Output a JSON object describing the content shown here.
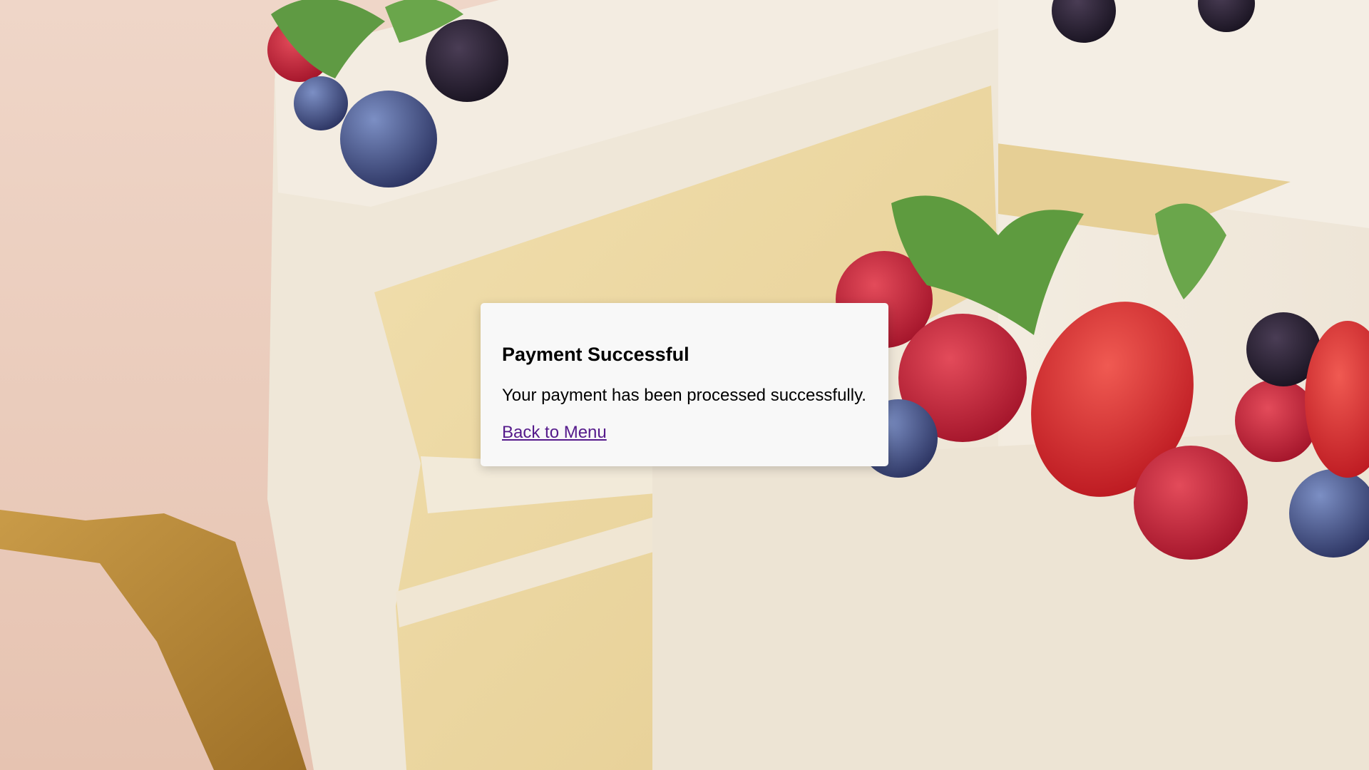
{
  "background": {
    "description_icon": "cake-photo",
    "colors": {
      "backdrop": "#e9cfc0",
      "frosting": "#efe6d6",
      "sponge": "#ead59f",
      "server": "#b98a3a"
    }
  },
  "dialog": {
    "title": "Payment Successful",
    "message": "Your payment has been processed successfully.",
    "link_label": "Back to Menu",
    "link_color": "#551a8b"
  }
}
